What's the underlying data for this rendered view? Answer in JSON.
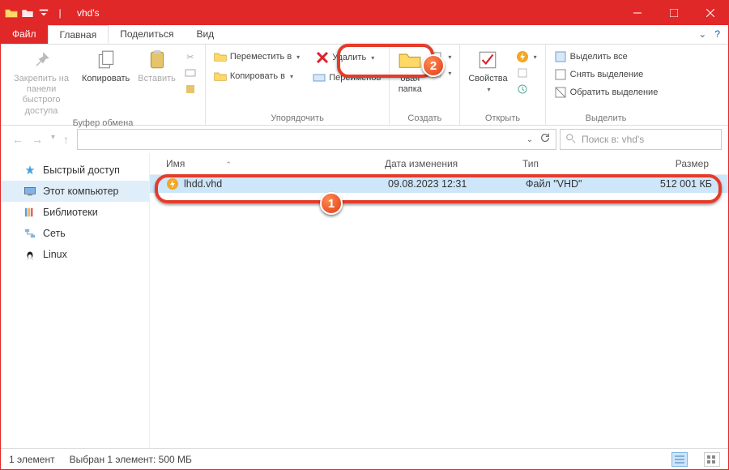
{
  "title": "vhd's",
  "menu": {
    "file": "Файл",
    "home": "Главная",
    "share": "Поделиться",
    "view": "Вид"
  },
  "ribbon": {
    "clipboard": {
      "pin": "Закрепить на панели\nбыстрого доступа",
      "copy": "Копировать",
      "paste": "Вставить",
      "label": "Буфер обмена"
    },
    "organize": {
      "move_to": "Переместить в",
      "copy_to": "Копировать в",
      "delete": "Удалить",
      "rename": "Переименов",
      "label": "Упорядочить"
    },
    "new": {
      "new_folder_line2": "папка",
      "new_folder_line1_frag": "овая",
      "label": "Создать"
    },
    "open": {
      "properties": "Свойства",
      "label": "Открыть"
    },
    "select": {
      "select_all": "Выделить все",
      "select_none": "Снять выделение",
      "invert": "Обратить выделение",
      "label": "Выделить"
    }
  },
  "search_placeholder": "Поиск в: vhd's",
  "sidebar": {
    "quick": "Быстрый доступ",
    "pc": "Этот компьютер",
    "libs": "Библиотеки",
    "net": "Сеть",
    "linux": "Linux"
  },
  "columns": {
    "name": "Имя",
    "date": "Дата изменения",
    "type": "Тип",
    "size": "Размер"
  },
  "file": {
    "name": "lhdd.vhd",
    "date": "09.08.2023 12:31",
    "type": "Файл \"VHD\"",
    "size": "512 001 КБ"
  },
  "status": {
    "count": "1 элемент",
    "selection": "Выбран 1 элемент: 500 МБ"
  },
  "badges": {
    "one": "1",
    "two": "2"
  }
}
